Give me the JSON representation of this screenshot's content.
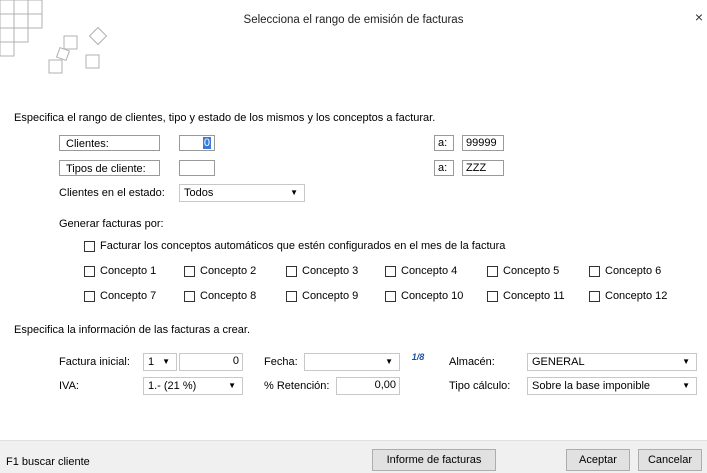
{
  "window": {
    "title": "Selecciona el rango de emisión de facturas",
    "close_symbol": "×"
  },
  "range_section": {
    "heading": "Especifica el rango de clientes, tipo y estado de los mismos y los conceptos a facturar.",
    "clientes_label": "Clientes:",
    "clientes_from": "0",
    "clientes_to_label": "a:",
    "clientes_to": "99999",
    "tipos_label": "Tipos de cliente:",
    "tipos_from": "",
    "tipos_to_label": "a:",
    "tipos_to": "ZZZ",
    "estado_label": "Clientes en el estado:",
    "estado_value": "Todos"
  },
  "generar": {
    "label": "Generar facturas por:",
    "auto_label": "Facturar los conceptos automáticos que estén configurados en el mes de la factura",
    "conceptos": [
      "Concepto 1",
      "Concepto 2",
      "Concepto 3",
      "Concepto 4",
      "Concepto 5",
      "Concepto 6",
      "Concepto 7",
      "Concepto 8",
      "Concepto 9",
      "Concepto 10",
      "Concepto 11",
      "Concepto 12"
    ]
  },
  "info_section": {
    "heading": "Especifica la información de las facturas a crear.",
    "factura_label": "Factura inicial:",
    "factura_serie": "1",
    "factura_numero": "0",
    "fecha_label": "Fecha:",
    "fecha_value": "",
    "calendar_icon_text": "1/8",
    "almacen_label": "Almacén:",
    "almacen_value": "GENERAL",
    "iva_label": "IVA:",
    "iva_value": "1.- (21 %)",
    "retencion_label": "% Retención:",
    "retencion_value": "0,00",
    "tipo_calculo_label": "Tipo cálculo:",
    "tipo_calculo_value": "Sobre la base imponible"
  },
  "footer": {
    "hint": "F1 buscar cliente",
    "informe_button": "Informe de facturas",
    "aceptar_button": "Aceptar",
    "cancelar_button": "Cancelar"
  },
  "icons": {
    "dropdown": "chevron-down-icon",
    "calendar": "calendar-icon",
    "close": "close-icon",
    "logo": "logo-grid-icon"
  }
}
